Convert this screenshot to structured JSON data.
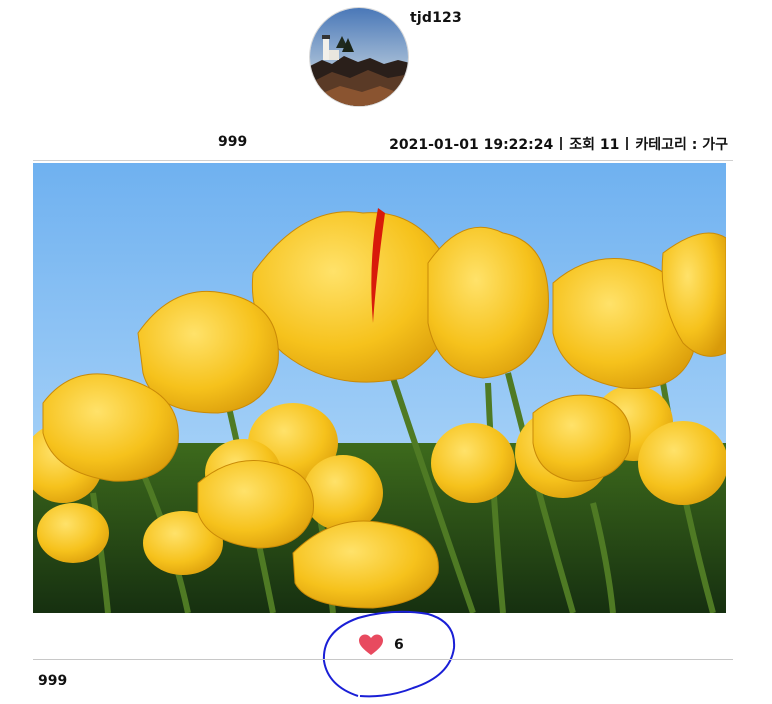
{
  "author": {
    "username": "tjd123",
    "avatar_icon": "profile-photo-lighthouse"
  },
  "post": {
    "title": "999",
    "date": "2021-01-01 19:22:24",
    "views_label": "조회 11",
    "category_label": "카테고리 : 가구",
    "image_icon": "photo-yellow-tulips",
    "content": "999"
  },
  "likes": {
    "count": "6",
    "icon": "heart-icon",
    "color": "#e84a5f"
  },
  "annotation_color": "#1a1fd6"
}
